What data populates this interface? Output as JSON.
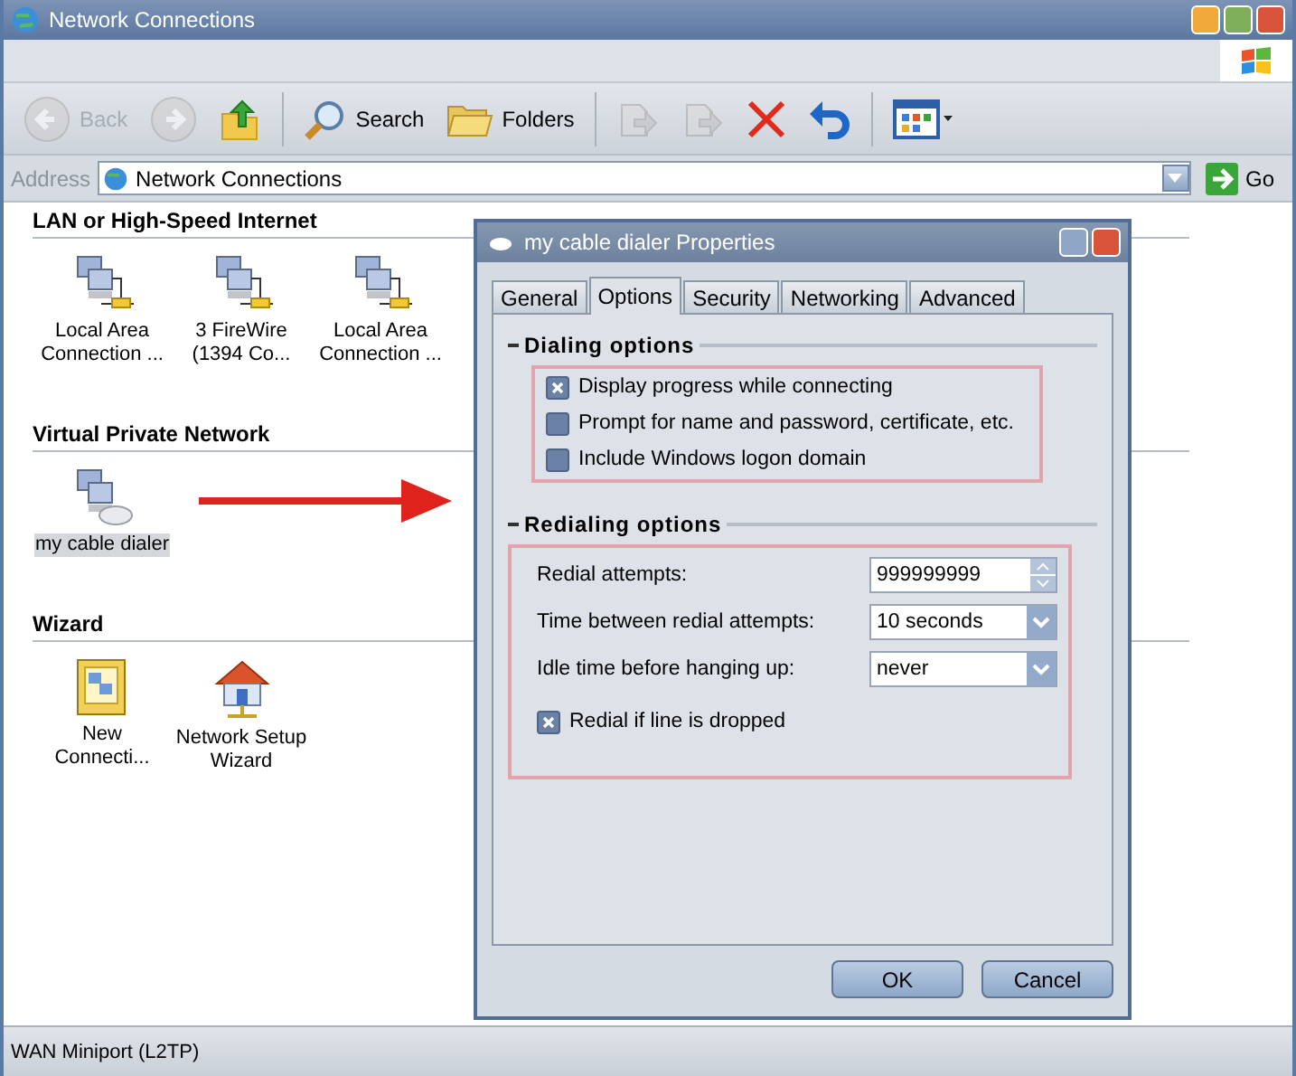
{
  "window": {
    "title": "Network Connections"
  },
  "toolbar": [
    {
      "kind": "back",
      "label": "Back",
      "disabled": true
    },
    {
      "kind": "forward",
      "disabled": true
    },
    {
      "kind": "up",
      "disabled": false
    },
    {
      "kind": "search",
      "label": "Search",
      "disabled": false
    },
    {
      "kind": "folders",
      "label": "Folders",
      "disabled": false
    },
    {
      "kind": "move",
      "disabled": true
    },
    {
      "kind": "copy",
      "disabled": true
    },
    {
      "kind": "delete",
      "disabled": false
    },
    {
      "kind": "undo",
      "disabled": false
    },
    {
      "kind": "views",
      "disabled": false
    }
  ],
  "address": {
    "label": "Address",
    "value": "Network Connections",
    "go": "Go"
  },
  "groups": [
    {
      "title": "LAN or High-Speed Internet",
      "items": [
        {
          "kind": "lan",
          "lines": [
            "Local Area",
            "Connection ..."
          ],
          "selected": false
        },
        {
          "kind": "lan",
          "lines": [
            "3 FireWire",
            "(1394 Co..."
          ],
          "selected": false
        },
        {
          "kind": "lan",
          "lines": [
            "Local Area",
            "Connection ..."
          ],
          "selected": false
        }
      ]
    },
    {
      "title": "Virtual Private Network",
      "items": [
        {
          "kind": "vpn",
          "lines": [
            "my cable dialer"
          ],
          "selected": true
        }
      ]
    },
    {
      "title": "Wizard",
      "items": [
        {
          "kind": "wizard",
          "lines": [
            "New",
            "Connecti..."
          ],
          "selected": false
        },
        {
          "kind": "house",
          "lines": [
            "Network Setup",
            "Wizard"
          ],
          "selected": false
        }
      ]
    }
  ],
  "dialog": {
    "title": "my cable dialer Properties",
    "tabs": [
      {
        "label": "General",
        "selected": false
      },
      {
        "label": "Options",
        "selected": true
      },
      {
        "label": "Security",
        "selected": false
      },
      {
        "label": "Networking",
        "selected": false
      },
      {
        "label": "Advanced",
        "selected": false
      }
    ],
    "dialing": {
      "title": "Dialing options",
      "options": [
        {
          "label": "Display progress while connecting",
          "checked": true
        },
        {
          "label": "Prompt for name and password, certificate, etc.",
          "checked": false
        },
        {
          "label": "Include Windows logon domain",
          "checked": false
        }
      ]
    },
    "redialing": {
      "title": "Redialing options",
      "fields": [
        {
          "kind": "spinner",
          "label": "Redial attempts:",
          "value": "999999999"
        },
        {
          "kind": "dropdown",
          "label": "Time between redial attempts:",
          "value": "10 seconds"
        },
        {
          "kind": "dropdown",
          "label": "Idle time before hanging up:",
          "value": "never"
        }
      ],
      "options": [
        {
          "label": "Redial if line is dropped",
          "checked": true
        }
      ]
    },
    "buttons": [
      "OK",
      "Cancel"
    ]
  },
  "status_bar": "WAN Miniport (L2TP)"
}
